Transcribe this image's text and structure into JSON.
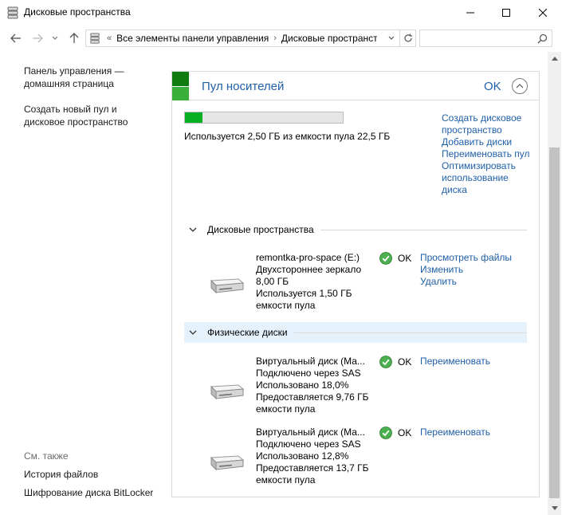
{
  "window": {
    "title": "Дисковые пространства"
  },
  "address": {
    "overflow": "«",
    "segments": [
      "Все элементы панели управления",
      "Дисковые пространст"
    ],
    "search_placeholder": ""
  },
  "sidebar": {
    "home_link": "Панель управления —\nдомашняя страница",
    "create_link": "Создать новый пул и\nдисковое пространство",
    "see_also": "См. также",
    "history_link": "История файлов",
    "bitlocker_link": "Шифрование диска BitLocker"
  },
  "pool": {
    "title": "Пул носителей",
    "status": "OK",
    "usage_fraction": 0.111,
    "usage_text": "Используется 2,50 ГБ из емкости пула 22,5 ГБ",
    "actions": [
      "Создать дисковое пространство",
      "Добавить диски",
      "Переименовать пул",
      "Оптимизировать использование диска"
    ]
  },
  "spaces_section": {
    "label": "Дисковые пространства",
    "items": [
      {
        "lines": [
          "remontka-pro-space (E:)",
          "Двухстороннее зеркало",
          "8,00 ГБ",
          "Используется 1,50 ГБ",
          "емкости пула"
        ],
        "status": "OK",
        "links": [
          "Просмотреть файлы",
          "Изменить",
          "Удалить"
        ]
      }
    ]
  },
  "disks_section": {
    "label": "Физические диски",
    "items": [
      {
        "lines": [
          "Виртуальный диск (Ма...",
          "Подключено через SAS",
          "Использовано 18,0%",
          "Предоставляется 9,76 ГБ",
          "емкости пула"
        ],
        "status": "OK",
        "links": [
          "Переименовать"
        ]
      },
      {
        "lines": [
          "Виртуальный диск (Ма...",
          "Подключено через SAS",
          "Использовано 12,8%",
          "Предоставляется 13,7 ГБ",
          "емкости пула"
        ],
        "status": "OK",
        "links": [
          "Переименовать"
        ]
      }
    ]
  },
  "colors": {
    "accent": "#1e5fa8",
    "green_dark": "#107c10",
    "green_light": "#3ab03a",
    "progress_fill": "#06b025",
    "ok_green": "#4caf50"
  }
}
